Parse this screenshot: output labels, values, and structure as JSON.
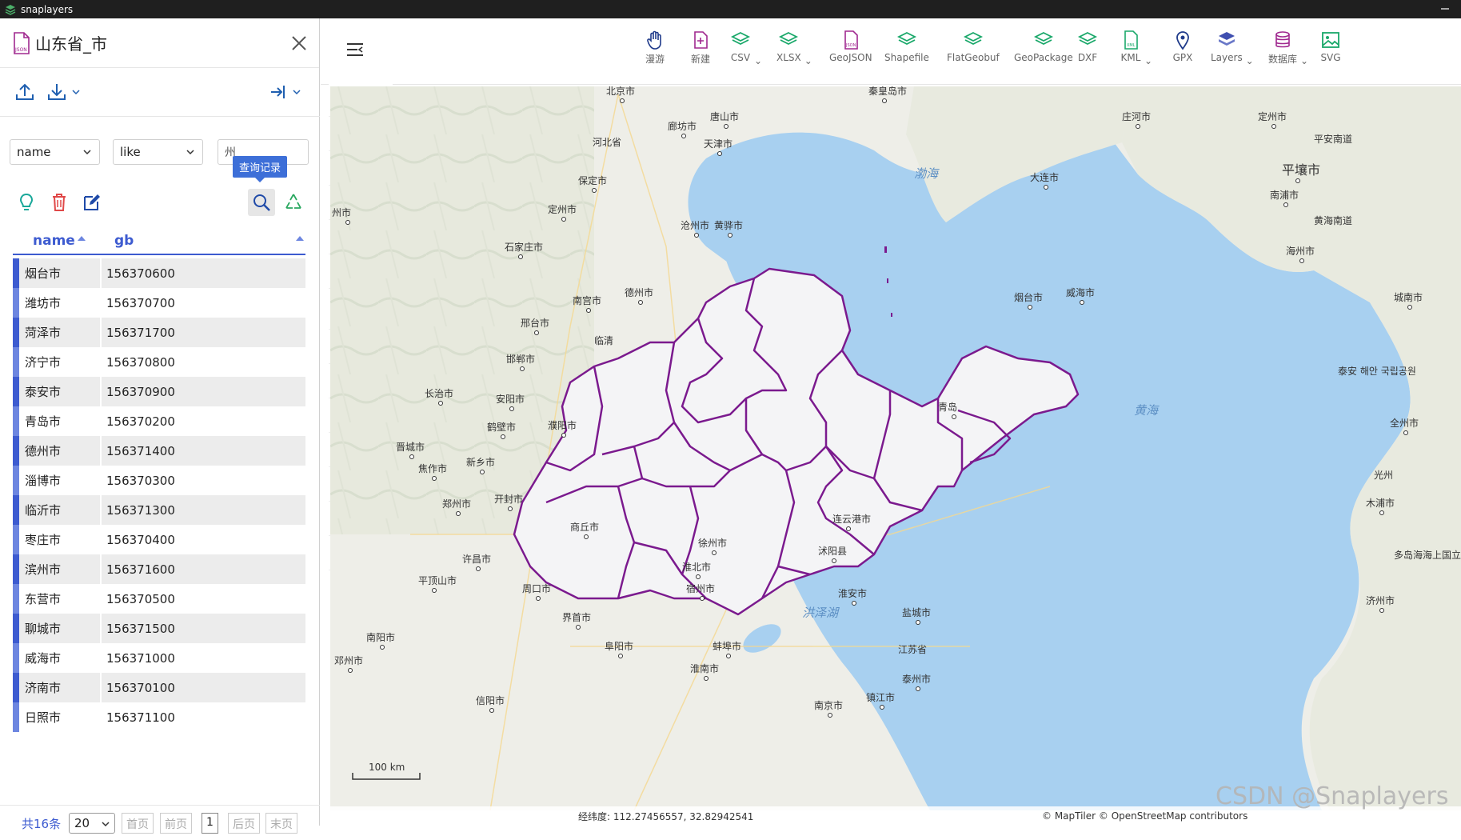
{
  "app": {
    "title": "snaplayers"
  },
  "layer": {
    "title": "山东省_市",
    "icon": "json-file-icon"
  },
  "filter": {
    "field": "name",
    "operator": "like",
    "value": "州",
    "query_tooltip": "查询记录"
  },
  "table": {
    "columns": [
      "name",
      "gb"
    ],
    "rows": [
      {
        "name": "烟台市",
        "gb": "156370600"
      },
      {
        "name": "潍坊市",
        "gb": "156370700"
      },
      {
        "name": "菏泽市",
        "gb": "156371700"
      },
      {
        "name": "济宁市",
        "gb": "156370800"
      },
      {
        "name": "泰安市",
        "gb": "156370900"
      },
      {
        "name": "青岛市",
        "gb": "156370200"
      },
      {
        "name": "德州市",
        "gb": "156371400"
      },
      {
        "name": "淄博市",
        "gb": "156370300"
      },
      {
        "name": "临沂市",
        "gb": "156371300"
      },
      {
        "name": "枣庄市",
        "gb": "156370400"
      },
      {
        "name": "滨州市",
        "gb": "156371600"
      },
      {
        "name": "东营市",
        "gb": "156370500"
      },
      {
        "name": "聊城市",
        "gb": "156371500"
      },
      {
        "name": "威海市",
        "gb": "156371000"
      },
      {
        "name": "济南市",
        "gb": "156370100"
      },
      {
        "name": "日照市",
        "gb": "156371100"
      }
    ]
  },
  "pager": {
    "total": "共16条",
    "page_size": "20",
    "first": "首页",
    "prev": "前页",
    "current": "1",
    "next": "后页",
    "last": "末页"
  },
  "toolbar": {
    "items": [
      {
        "label": "漫游",
        "icon": "hand-pan-icon"
      },
      {
        "label": "新建",
        "icon": "new-file-icon"
      },
      {
        "label": "CSV",
        "icon": "layers-stack-icon",
        "dropdown": "⌄"
      },
      {
        "label": "XLSX",
        "icon": "layers-stack-icon",
        "dropdown": "⌄"
      },
      {
        "label": "GeoJSON",
        "icon": "json-file-icon"
      },
      {
        "label": "Shapefile",
        "icon": "layers-stack-icon"
      },
      {
        "label": "FlatGeobuf",
        "icon": "layers-stack-icon"
      },
      {
        "label": "GeoPackage",
        "icon": "layers-stack-icon"
      },
      {
        "label": "DXF",
        "icon": "layers-stack-icon"
      },
      {
        "label": "KML",
        "icon": "xml-file-icon",
        "dropdown": "⌄"
      },
      {
        "label": "GPX",
        "icon": "location-pin-icon"
      },
      {
        "label": "Layers",
        "icon": "layers-filled-icon",
        "dropdown": "⌄"
      },
      {
        "label": "数据库",
        "icon": "database-icon",
        "dropdown": "⌄"
      },
      {
        "label": "SVG",
        "icon": "image-icon"
      }
    ]
  },
  "sidebar_tools": [
    "home-icon",
    "zoom-in-icon",
    "zoom-out-icon",
    "full-extent-icon",
    "target-icon",
    "pin-icon",
    "ruler-icon",
    "clear-icon",
    "bookmark-icon",
    "globe-icon",
    "locate-icon",
    "brush-icon",
    "text-tool-icon",
    "hammer-icon"
  ],
  "map": {
    "labels": [
      {
        "text": "北京市"
      },
      {
        "text": "秦皇岛市"
      },
      {
        "text": "唐山市"
      },
      {
        "text": "廊坊市"
      },
      {
        "text": "天津市"
      },
      {
        "text": "河北省"
      },
      {
        "text": "保定市"
      },
      {
        "text": "定州市"
      },
      {
        "text": "沧州市"
      },
      {
        "text": "黄骅市"
      },
      {
        "text": "石家庄市"
      },
      {
        "text": "南宫市"
      },
      {
        "text": "德州市"
      },
      {
        "text": "邢台市"
      },
      {
        "text": "临清"
      },
      {
        "text": "邯郸市"
      },
      {
        "text": "长治市"
      },
      {
        "text": "安阳市"
      },
      {
        "text": "鹤壁市"
      },
      {
        "text": "濮阳市"
      },
      {
        "text": "晋城市"
      },
      {
        "text": "新乡市"
      },
      {
        "text": "焦作市"
      },
      {
        "text": "郑州市"
      },
      {
        "text": "开封市"
      },
      {
        "text": "商丘市"
      },
      {
        "text": "徐州市"
      },
      {
        "text": "许昌市"
      },
      {
        "text": "淮北市"
      },
      {
        "text": "沭阳县"
      },
      {
        "text": "平顶山市"
      },
      {
        "text": "周口市"
      },
      {
        "text": "宿州市"
      },
      {
        "text": "淮安市"
      },
      {
        "text": "盐城市"
      },
      {
        "text": "界首市"
      },
      {
        "text": "南阳市"
      },
      {
        "text": "阜阳市"
      },
      {
        "text": "蚌埠市"
      },
      {
        "text": "洪泽湖"
      },
      {
        "text": "邓州市"
      },
      {
        "text": "淮南市"
      },
      {
        "text": "泰州市"
      },
      {
        "text": "镇江市"
      },
      {
        "text": "江苏省"
      },
      {
        "text": "信阳市"
      },
      {
        "text": "南京市"
      },
      {
        "text": "连云港市"
      },
      {
        "text": "渤海"
      },
      {
        "text": "大连市"
      },
      {
        "text": "庄河市"
      },
      {
        "text": "定州市"
      },
      {
        "text": "平壤市"
      },
      {
        "text": "南浦市"
      },
      {
        "text": "海州市"
      },
      {
        "text": "烟台市"
      },
      {
        "text": "威海市"
      },
      {
        "text": "青岛"
      },
      {
        "text": "黄海"
      },
      {
        "text": "城南市"
      },
      {
        "text": "全州市"
      },
      {
        "text": "光州"
      },
      {
        "text": "木浦市"
      },
      {
        "text": "济州市"
      },
      {
        "text": "平安南道"
      },
      {
        "text": "黄海南道"
      },
      {
        "text": "泰安 해안 국립공원"
      },
      {
        "text": "多岛海海上国立公园"
      },
      {
        "text": "州市"
      },
      {
        "text": "100 km"
      }
    ]
  },
  "status": {
    "coord_label": "经纬度: 112.27456557, 32.82942541",
    "attribution": "© MapTiler © OpenStreetMap contributors",
    "watermark": "CSDN @Snaplayers"
  },
  "colors": {
    "accent": "#3d5bd0",
    "boundary": "#7b1a8e",
    "sea": "#a8d0f0",
    "land": "#eeeee6",
    "polygon_fill": "#f3f3f3"
  }
}
